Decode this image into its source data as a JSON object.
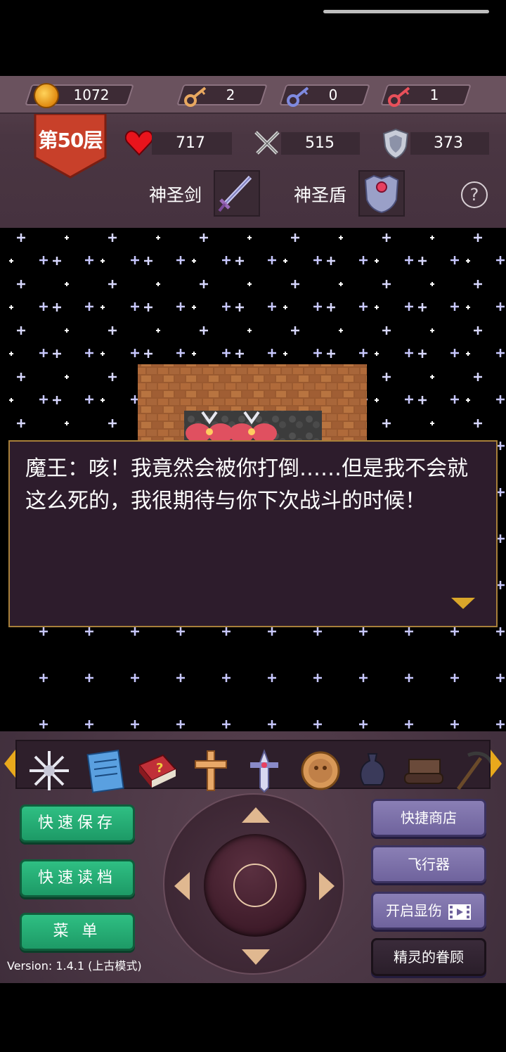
{
  "resources": {
    "gold": "1072",
    "yellow_keys": "2",
    "blue_keys": "0",
    "red_keys": "1"
  },
  "floor": {
    "label": "第50层"
  },
  "stats": {
    "hp": "717",
    "attack": "515",
    "defense": "373"
  },
  "equipment": {
    "weapon_label": "神圣剑",
    "shield_label": "神圣盾"
  },
  "help": {
    "symbol": "?"
  },
  "dialog": {
    "text": "魔王：咳！我竟然会被你打倒……但是我不会就这么死的，我很期待与你下次战斗的时候！"
  },
  "items": [
    {
      "icon": "snowflake-icon"
    },
    {
      "icon": "notebook-icon"
    },
    {
      "icon": "monster-book-icon"
    },
    {
      "icon": "cross-icon"
    },
    {
      "icon": "holy-sword-emblem-icon"
    },
    {
      "icon": "coin-face-icon"
    },
    {
      "icon": "vase-icon"
    },
    {
      "icon": "scroll-icon"
    },
    {
      "icon": "pickaxe-icon"
    }
  ],
  "buttons": {
    "quick_save": "快速保存",
    "quick_load": "快速读档",
    "menu": "菜 单",
    "quick_shop": "快捷商店",
    "flyer": "飞行器",
    "show_damage": "开启显伤",
    "fairy_favor": "精灵的眷顾"
  },
  "version": "Version: 1.4.1 (上古模式)",
  "colors": {
    "accent_green": "#22a870",
    "accent_purple": "#7c70aa",
    "gold_arrow": "#e9a91c",
    "dialog_border": "#a8803a"
  }
}
